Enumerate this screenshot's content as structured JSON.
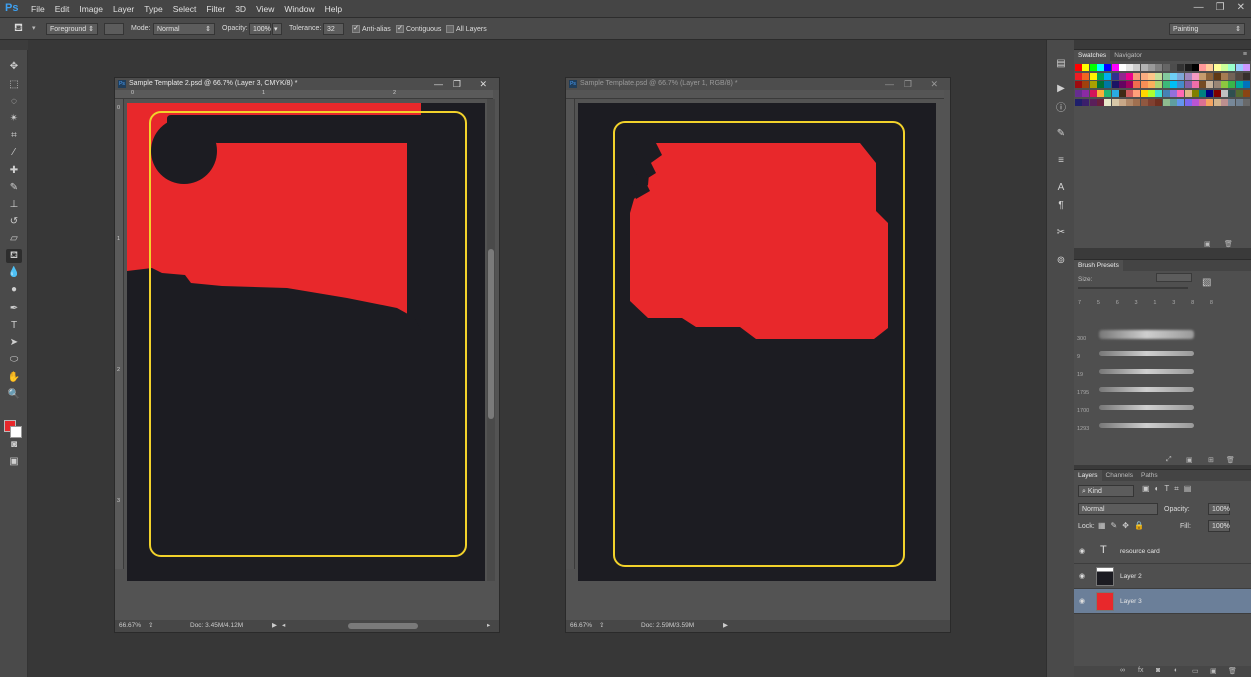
{
  "app": {
    "logo": "Ps"
  },
  "menu": [
    "File",
    "Edit",
    "Image",
    "Layer",
    "Type",
    "Select",
    "Filter",
    "3D",
    "View",
    "Window",
    "Help"
  ],
  "window_controls": {
    "minimize": "—",
    "restore": "❐",
    "close": "✕"
  },
  "options": {
    "fill_source": "Foreground",
    "mode_label": "Mode:",
    "mode_value": "Normal",
    "opacity_label": "Opacity:",
    "opacity_value": "100%",
    "tolerance_label": "Tolerance:",
    "tolerance_value": "32",
    "antialias_label": "Anti-alias",
    "contiguous_label": "Contiguous",
    "alllayers_label": "All Layers",
    "workspace": "Painting"
  },
  "colors": {
    "foreground": "#e8282b",
    "background": "#ffffff",
    "card_red": "#e8282b",
    "card_bg": "#1c1c22",
    "frame_yellow": "#f2d22b"
  },
  "doc1": {
    "title": "Sample Template 2.psd @ 66.7% (Layer 3, CMYK/8) *",
    "zoom": "66.67%",
    "doc_size": "Doc: 3.45M/4.12M",
    "ruler_marks": [
      "0",
      "1",
      "2",
      "3"
    ]
  },
  "doc2": {
    "title": "Sample Template.psd @ 66.7% (Layer 1, RGB/8) *",
    "zoom": "66.67%",
    "doc_size": "Doc: 2.59M/3.59M"
  },
  "swatches_panel": {
    "tabs": [
      "Swatches",
      "Navigator"
    ]
  },
  "brush_panel": {
    "tab": "Brush Presets",
    "size_label": "Size:",
    "small_sizes": [
      "7",
      "5",
      "6",
      "3",
      "1",
      "3",
      "8",
      "8"
    ],
    "strokes": [
      "300",
      "9",
      "19",
      "1795",
      "1700",
      "1293"
    ]
  },
  "layers_panel": {
    "tabs": [
      "Layers",
      "Channels",
      "Paths"
    ],
    "filter": "Kind",
    "blend_mode": "Normal",
    "opacity_label": "Opacity:",
    "opacity_value": "100%",
    "lock_label": "Lock:",
    "fill_label": "Fill:",
    "fill_value": "100%",
    "layers": [
      {
        "name": "resource card",
        "type": "text"
      },
      {
        "name": "Layer 2",
        "type": "image"
      },
      {
        "name": "Layer 3",
        "type": "fill",
        "selected": true
      }
    ]
  }
}
